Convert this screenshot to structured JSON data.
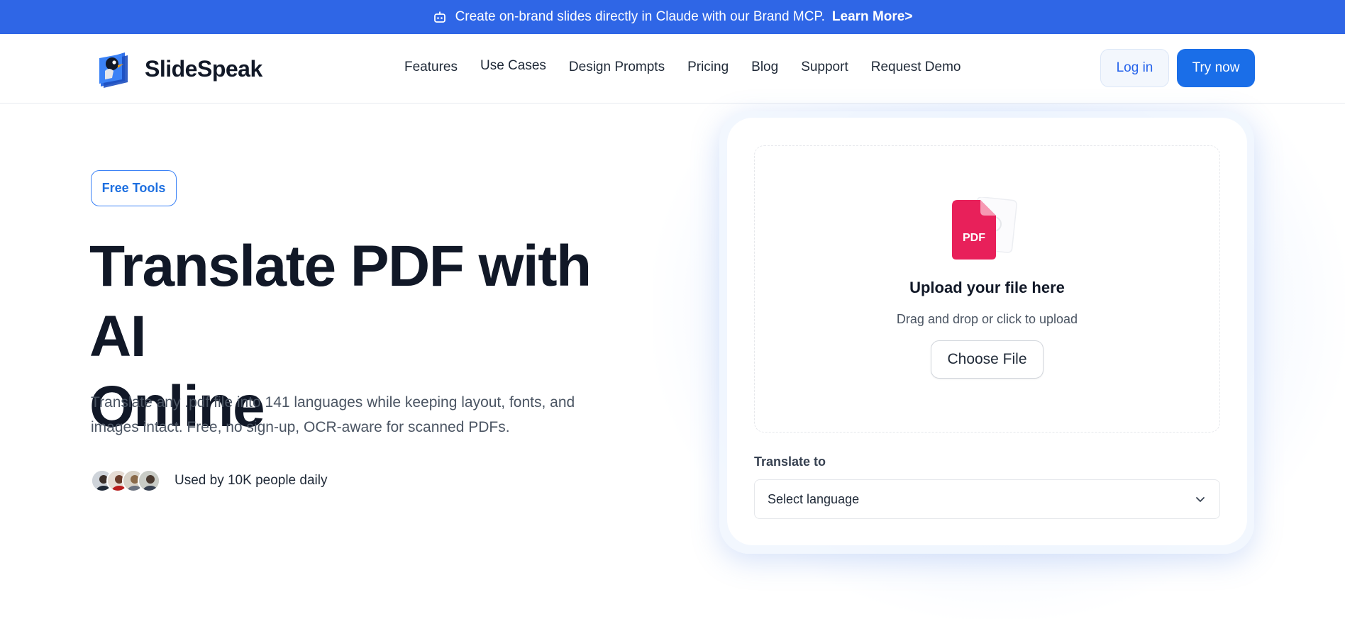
{
  "banner": {
    "icon": "robot-icon",
    "text": "Create on-brand slides directly in Claude with our Brand MCP.",
    "link": "Learn More>"
  },
  "header": {
    "logo_text": "SlideSpeak",
    "nav": [
      "Features",
      "Use Cases",
      "Design Prompts",
      "Pricing",
      "Blog",
      "Support",
      "Request Demo"
    ],
    "login_label": "Log in",
    "try_label": "Try now"
  },
  "hero": {
    "badge": "Free Tools",
    "title_line1": "Translate PDF with AI",
    "title_line2": "Online",
    "subtitle_line1": "Translate any .pdf file into 141 languages while keeping layout, fonts, and",
    "subtitle_line2": "images intact. Free, no sign-up, OCR-aware for scanned PDFs.",
    "users_text": "Used by 10K people daily"
  },
  "upload": {
    "file_badge": "PDF",
    "title": "Upload your file here",
    "subtitle": "Drag and drop or click to upload",
    "choose_label": "Choose File",
    "translate_label": "Translate to",
    "select_value": "Select language"
  },
  "colors": {
    "banner": "#2f66e6",
    "primary": "#1a6ee8",
    "pdf_icon": "#e8205a",
    "text_dark": "#111827"
  }
}
